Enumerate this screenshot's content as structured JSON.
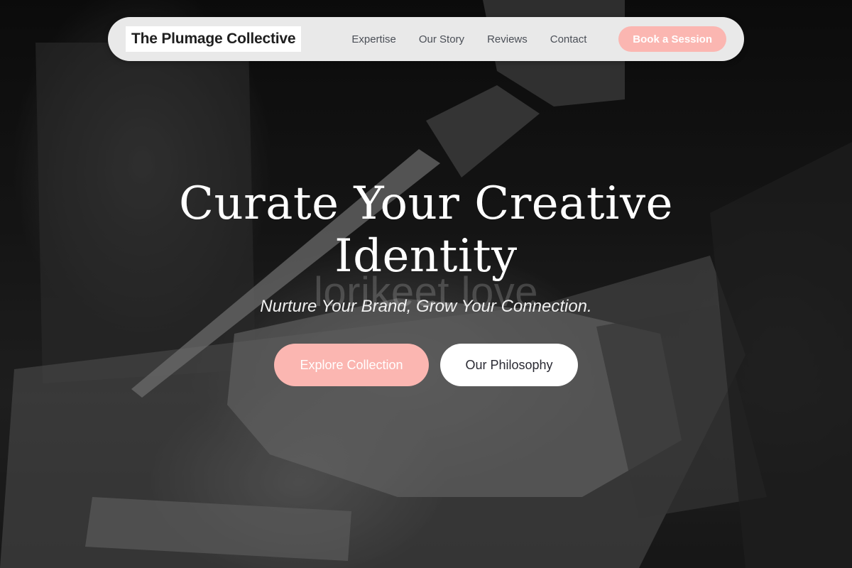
{
  "brand": {
    "name": "The Plumage Collective"
  },
  "nav": {
    "links": [
      {
        "label": "Expertise"
      },
      {
        "label": "Our Story"
      },
      {
        "label": "Reviews"
      },
      {
        "label": "Contact"
      }
    ],
    "cta_label": "Book a Session"
  },
  "hero": {
    "title": "Curate Your Creative Identity",
    "watermark": "lorikeet love",
    "subtitle": "Nurture Your Brand, Grow Your Connection.",
    "primary_button": "Explore Collection",
    "secondary_button": "Our Philosophy"
  },
  "colors": {
    "accent": "#fbb6b1",
    "navbar_bg": "#e9e9e9",
    "text_light": "#ffffff",
    "nav_text": "#4b4f57"
  }
}
